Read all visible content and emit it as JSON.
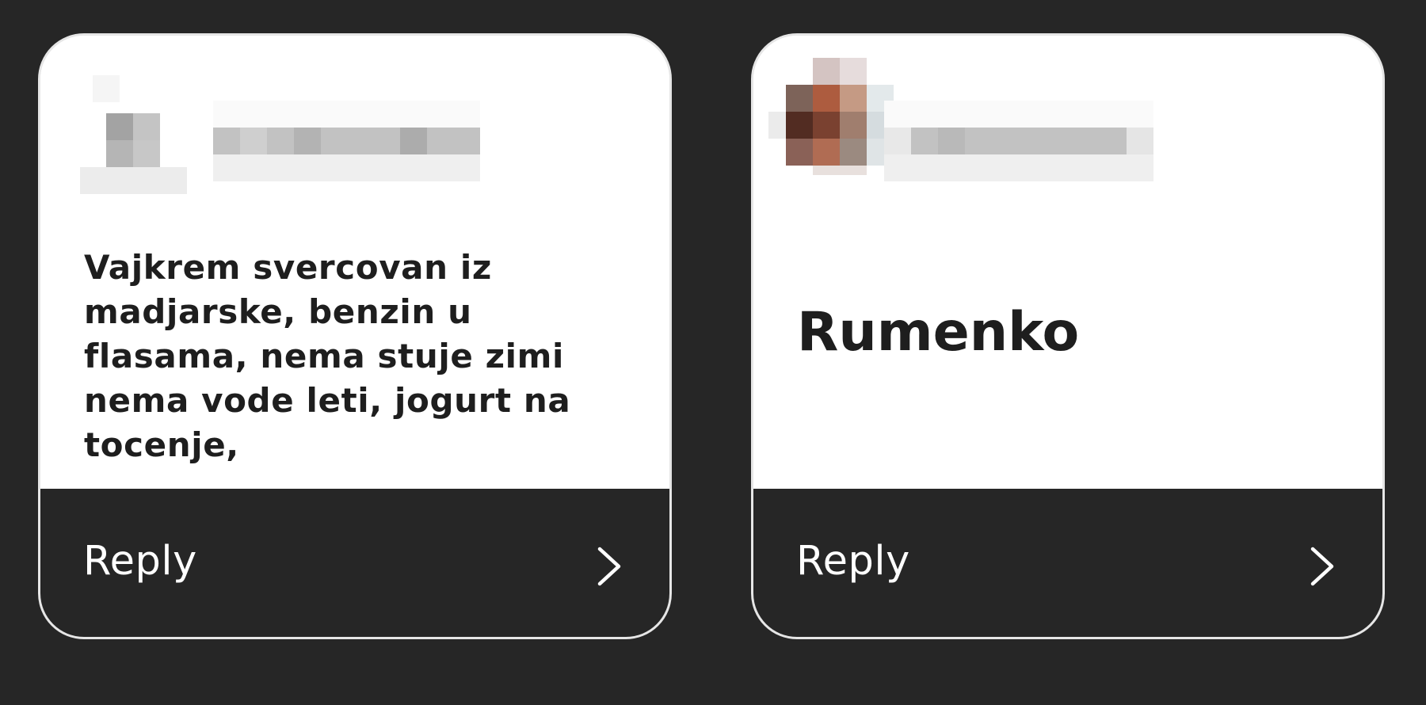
{
  "cards": [
    {
      "message": "Vajkrem svercovan iz madjarske, benzin u flasama, nema stuje zimi nema vode leti, jogurt na tocenje,",
      "reply_label": "Reply",
      "chevron_icon": "chevron-right-icon",
      "avatar": "redacted-avatar",
      "username": "redacted-username"
    },
    {
      "message": "Rumenko",
      "reply_label": "Reply",
      "chevron_icon": "chevron-right-icon",
      "avatar": "redacted-avatar",
      "username": "redacted-username"
    }
  ],
  "colors": {
    "background": "#262626",
    "card": "#ffffff",
    "footer": "#262626",
    "text": "#1e1e1e",
    "reply_text": "#ffffff"
  }
}
